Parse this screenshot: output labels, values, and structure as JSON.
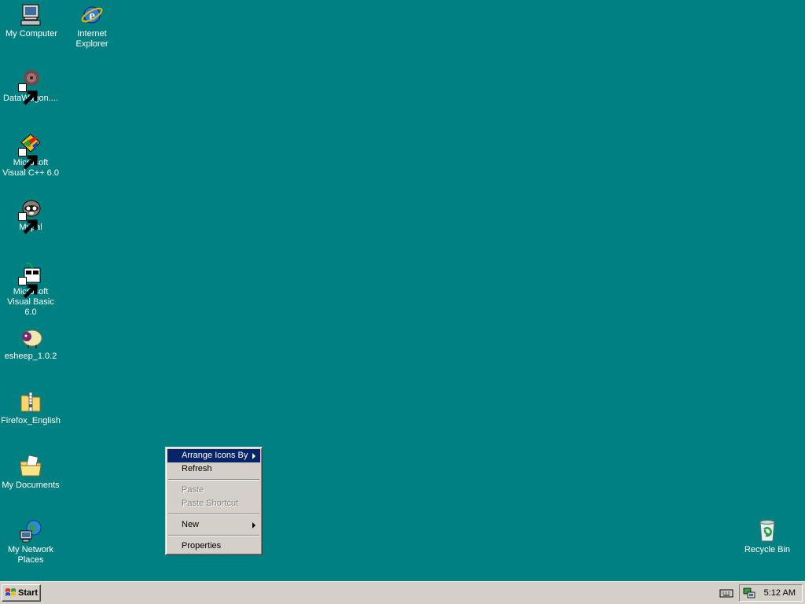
{
  "desktop": {
    "background": "#008080",
    "icons": [
      {
        "label": "My Computer",
        "icon": "my-computer-icon"
      },
      {
        "label": "Internet Explorer",
        "icon": "internet-explorer-icon"
      },
      {
        "label": "DataWagon....",
        "icon": "datawagon-icon"
      },
      {
        "label": "Microsoft Visual C++ 6.0",
        "icon": "visual-cpp-icon"
      },
      {
        "label": "Mypal",
        "icon": "mypal-icon"
      },
      {
        "label": "Microsoft Visual Basic 6.0",
        "icon": "visual-basic-icon"
      },
      {
        "label": "esheep_1.0.2",
        "icon": "esheep-icon"
      },
      {
        "label": "Firefox_English",
        "icon": "zip-folder-icon"
      },
      {
        "label": "My Documents",
        "icon": "my-documents-icon"
      },
      {
        "label": "My Network Places",
        "icon": "network-places-icon"
      },
      {
        "label": "Recycle Bin",
        "icon": "recycle-bin-icon"
      }
    ]
  },
  "context_menu": {
    "items": [
      {
        "label": "Arrange Icons By",
        "submenu": true,
        "highlighted": true,
        "enabled": true
      },
      {
        "label": "Refresh",
        "submenu": false,
        "highlighted": false,
        "enabled": true
      },
      {
        "label": "Paste",
        "submenu": false,
        "highlighted": false,
        "enabled": false
      },
      {
        "label": "Paste Shortcut",
        "submenu": false,
        "highlighted": false,
        "enabled": false
      },
      {
        "label": "New",
        "submenu": true,
        "highlighted": false,
        "enabled": true
      },
      {
        "label": "Properties",
        "submenu": false,
        "highlighted": false,
        "enabled": true
      }
    ],
    "highlight_color": "#0a246a"
  },
  "taskbar": {
    "start_label": "Start",
    "clock": "5:12 AM",
    "tray_icons": [
      "keyboard-icon",
      "network-tray-icon"
    ]
  }
}
